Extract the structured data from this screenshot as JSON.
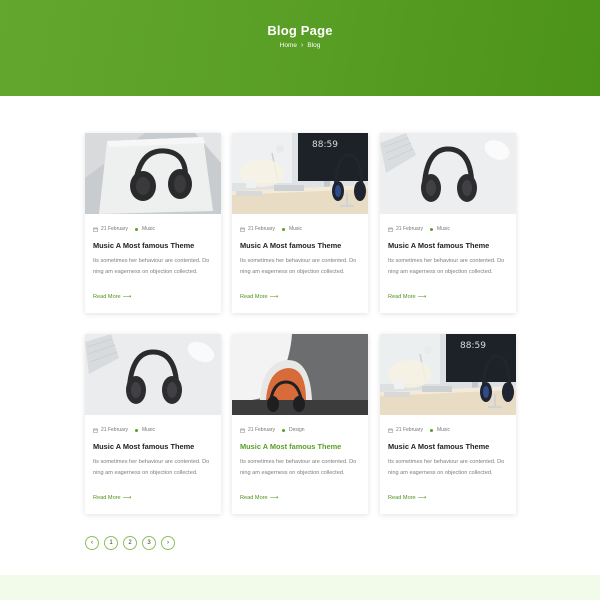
{
  "hero": {
    "title": "Blog Page",
    "breadcrumb": {
      "home": "Home",
      "separator": "›",
      "current": "Blog"
    }
  },
  "posts": [
    {
      "date": "21 February",
      "category": "Music",
      "title": "Music A Most famous Theme",
      "excerpt": "Its sometimes her behaviour are contented. Do ning am eagerness on objection collected.",
      "read_more": "Read More",
      "image": "headphones-on-pad"
    },
    {
      "date": "21 February",
      "category": "Music",
      "title": "Music A Most famous Theme",
      "excerpt": "Its sometimes her behaviour are contented. Do ning am eagerness on objection collected.",
      "read_more": "Read More",
      "image": "desk-with-monitor"
    },
    {
      "date": "21 February",
      "category": "Music",
      "title": "Music A Most famous Theme",
      "excerpt": "Its sometimes her behaviour are contented. Do ning am eagerness on objection collected.",
      "read_more": "Read More",
      "image": "headphones-keyboard-mouse"
    },
    {
      "date": "21 February",
      "category": "Music",
      "title": "Music A Most famous Theme",
      "excerpt": "Its sometimes her behaviour are contented. Do ning am eagerness on objection collected.",
      "read_more": "Read More",
      "image": "headphones-keyboard-mouse"
    },
    {
      "date": "21 February",
      "category": "Design",
      "title": "Music A Most famous Theme",
      "excerpt": "Its sometimes her behaviour are contented. Do ning am eagerness on objection collected.",
      "read_more": "Read More",
      "image": "headphones-on-stand",
      "title_highlighted": true
    },
    {
      "date": "21 February",
      "category": "Music",
      "title": "Music A Most famous Theme",
      "excerpt": "Its sometimes her behaviour are contented. Do ning am eagerness on objection collected.",
      "read_more": "Read More",
      "image": "desk-with-monitor"
    }
  ],
  "pagination": {
    "prev": "‹",
    "pages": [
      "1",
      "2",
      "3"
    ],
    "next": "›"
  },
  "colors": {
    "accent": "#5a9f26",
    "hero_start": "#63a72e",
    "hero_end": "#4c9319",
    "footer_band": "#f2fbea"
  }
}
